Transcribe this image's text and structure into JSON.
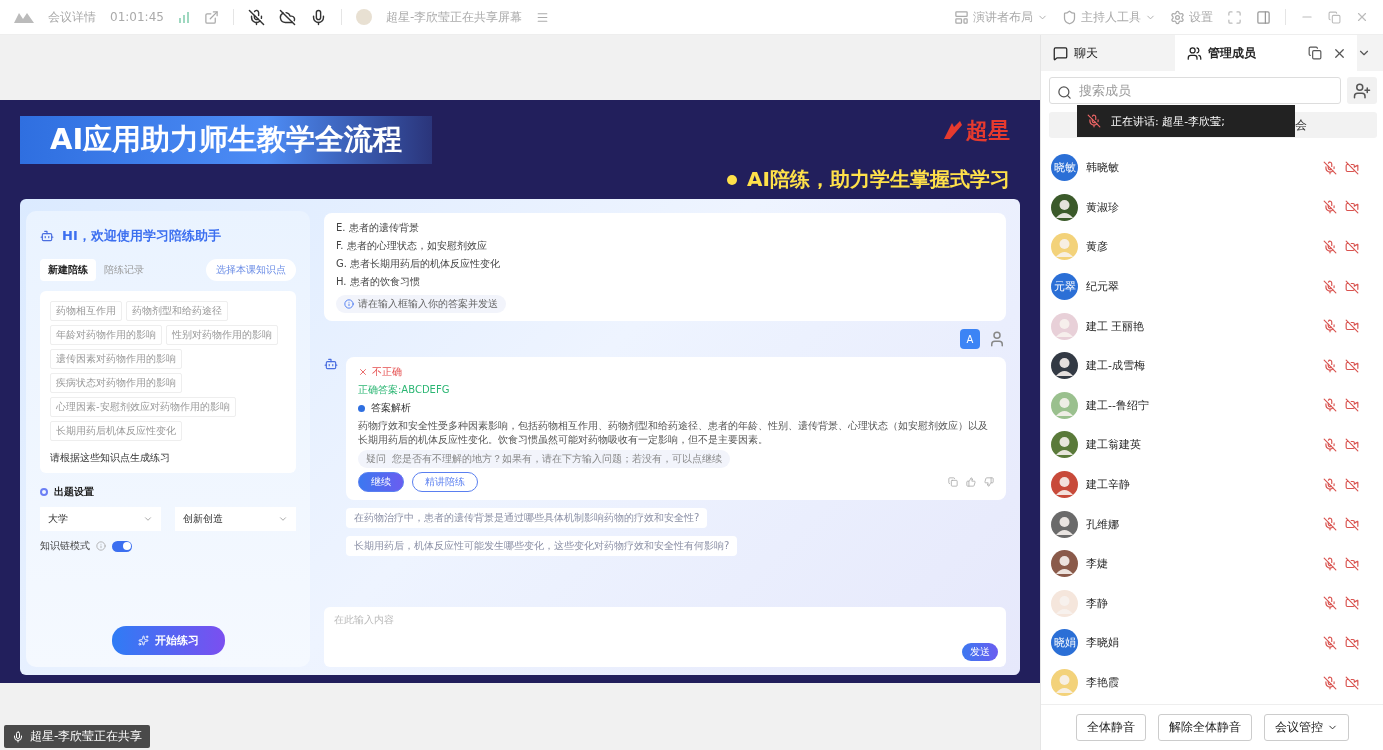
{
  "top_bar": {
    "title": "会议详情",
    "timer": "01:01:45",
    "sharing": "超星-李欣莹正在共享屏幕",
    "right": [
      {
        "kind": "layout",
        "label": "演讲者布局"
      },
      {
        "kind": "host",
        "label": "主持人工具"
      },
      {
        "kind": "settings",
        "label": "设置"
      }
    ]
  },
  "slide": {
    "title": "AI应用助力师生教学全流程",
    "logo": "超星",
    "subtitle": "AI陪练，助力学生掌握式学习",
    "left": {
      "greeting": "HI，欢迎使用学习陪练助手",
      "tabs": [
        {
          "label": "新建陪练",
          "selected": true
        },
        {
          "label": "陪练记录",
          "selected": false
        }
      ],
      "pick": "选择本课知识点",
      "chips": [
        "药物相互作用",
        "药物剂型和给药途径",
        "年龄对药物作用的影响",
        "性别对药物作用的影响",
        "遗传因素对药物作用的影响",
        "疾病状态对药物作用的影响",
        "心理因素-安慰剂效应对药物作用的影响",
        "长期用药后机体反应性变化"
      ],
      "prompt": "请根据这些知识点生成练习",
      "settings_title": "出题设置",
      "selects": [
        "大学",
        "创新创造"
      ],
      "mode": {
        "label": "知识链模式",
        "on": true
      },
      "start": "开始练习"
    },
    "chat": {
      "options": [
        "E. 患者的遗传背景",
        "F. 患者的心理状态，如安慰剂效应",
        "G. 患者长期用药后的机体反应性变化",
        "H. 患者的饮食习惯"
      ],
      "hint": "请在输入框输入你的答案并发送",
      "user_answer": "A",
      "verdict": {
        "label": "不正确",
        "correct": false
      },
      "answer": "正确答案:ABCDEFG",
      "analysis_title": "答案解析",
      "analysis": "药物疗效和安全性受多种因素影响，包括药物相互作用、药物剂型和给药途径、患者的年龄、性别、遗传背景、心理状态（如安慰剂效应）以及长期用药后的机体反应性变化。饮食习惯虽然可能对药物吸收有一定影响，但不是主要因素。",
      "doubt_tag": "疑问",
      "doubt": "您是否有不理解的地方？如果有，请在下方输入问题；若没有，可以点继续",
      "buttons": [
        {
          "label": "继续",
          "kind": "primary"
        },
        {
          "label": "精讲陪练",
          "kind": "outline"
        }
      ],
      "suggestions": [
        "在药物治疗中，患者的遗传背景是通过哪些具体机制影响药物的疗效和安全性?",
        "长期用药后，机体反应性可能发生哪些变化，这些变化对药物疗效和安全性有何影响?"
      ],
      "input": {
        "placeholder": "在此输入内容"
      },
      "send": "发送"
    }
  },
  "status": "超星-李欣莹正在共享",
  "sidebar": {
    "tabs": [
      {
        "kind": "chat",
        "label": "聊天",
        "selected": false
      },
      {
        "kind": "members",
        "label": "管理成员",
        "selected": true
      }
    ],
    "search": {
      "placeholder": "搜索成员"
    },
    "filter_visible": "会",
    "speaking": "正在讲话:  超星-李欣莹;",
    "members": [
      {
        "name": "韩晓敏",
        "avatar": {
          "kind": "text",
          "label": "晓敏"
        },
        "muted": true,
        "camera_off": true
      },
      {
        "name": "黄淑珍",
        "muted": true,
        "camera_off": true
      },
      {
        "name": "黄彦",
        "muted": true,
        "camera_off": true
      },
      {
        "name": "纪元翠",
        "avatar": {
          "kind": "text",
          "label": "元翠"
        },
        "muted": true,
        "camera_off": true
      },
      {
        "name": "建工 王丽艳",
        "muted": true,
        "camera_off": true
      },
      {
        "name": "建工-成雪梅",
        "muted": true,
        "camera_off": true
      },
      {
        "name": "建工--鲁绍宁",
        "muted": true,
        "camera_off": true
      },
      {
        "name": "建工翁建英",
        "muted": true,
        "camera_off": true
      },
      {
        "name": "建工辛静",
        "muted": true,
        "camera_off": true
      },
      {
        "name": "孔维娜",
        "muted": true,
        "camera_off": true
      },
      {
        "name": "李婕",
        "muted": true,
        "camera_off": true
      },
      {
        "name": "李静",
        "muted": true,
        "camera_off": true
      },
      {
        "name": "李晓娟",
        "avatar": {
          "kind": "text",
          "label": "晓娟"
        },
        "muted": true,
        "camera_off": true
      },
      {
        "name": "李艳霞",
        "muted": true,
        "camera_off": true
      }
    ],
    "buttons": [
      {
        "label": "全体静音",
        "menu": false
      },
      {
        "label": "解除全体静音",
        "menu": false
      },
      {
        "label": "会议管控",
        "menu": true
      }
    ]
  }
}
